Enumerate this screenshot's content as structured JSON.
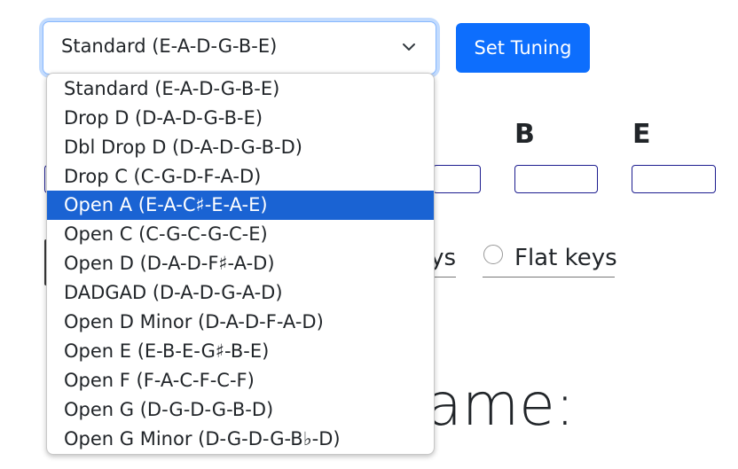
{
  "tuning_select": {
    "value": "Standard (E-A-D-G-B-E)",
    "options": [
      "Standard (E-A-D-G-B-E)",
      "Drop D (D-A-D-G-B-E)",
      "Dbl Drop D (D-A-D-G-B-D)",
      "Drop C (C-G-D-F-A-D)",
      "Open A (E-A-C♯-E-A-E)",
      "Open C (C-G-C-G-C-E)",
      "Open D (D-A-D-F♯-A-D)",
      "DADGAD (D-A-D-G-A-D)",
      "Open D Minor (D-A-D-F-A-D)",
      "Open E (E-B-E-G♯-B-E)",
      "Open F (F-A-C-F-C-F)",
      "Open G (D-G-D-G-B-D)",
      "Open G Minor (D-G-D-G-B♭-D)"
    ],
    "highlighted": "Open A (E-A-C♯-E-A-E)"
  },
  "set_tuning_button": "Set Tuning",
  "strings": {
    "label_b": "B",
    "label_e": "E"
  },
  "key_options": {
    "sharp_fragment": "ys",
    "flat_label": "Flat keys"
  },
  "heading_fragment": "ame:",
  "colors": {
    "primary": "#0d6efd",
    "highlight": "#1a63d3",
    "focus_border": "#86b7fe",
    "input_border": "#1d1d8f"
  }
}
